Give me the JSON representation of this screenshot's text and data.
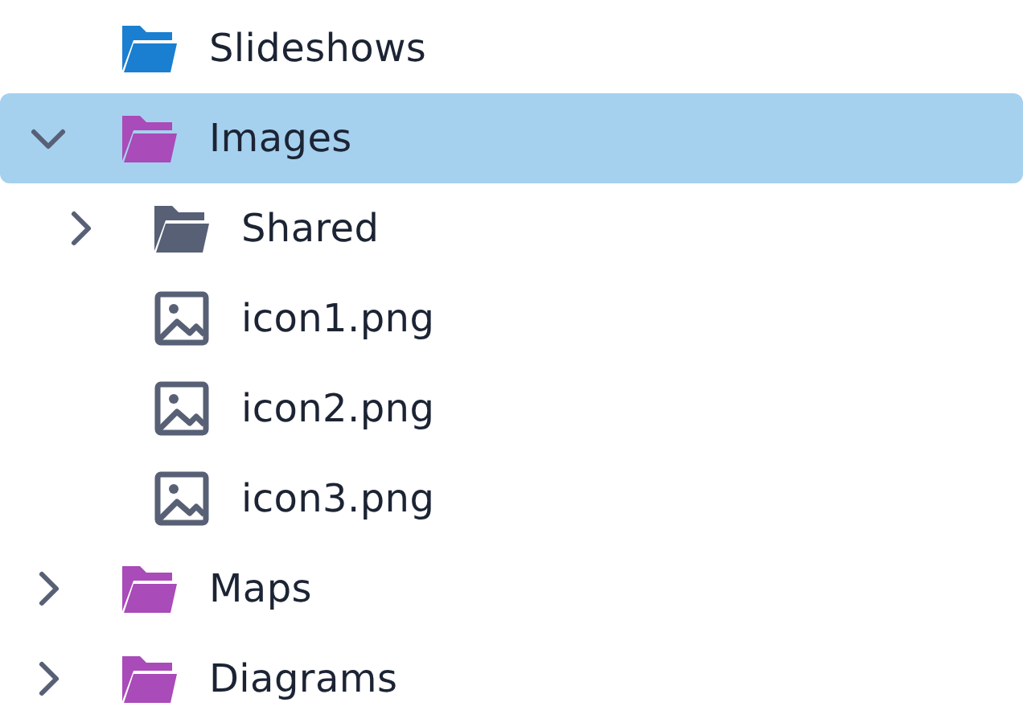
{
  "tree": [
    {
      "label": "Slideshows",
      "kind": "folder",
      "color": "#1a7fd0",
      "selected": false
    },
    {
      "label": "Images",
      "kind": "folder",
      "color": "#a94bb8",
      "expanded": true,
      "selected": true,
      "children": [
        {
          "label": "Shared",
          "kind": "folder",
          "color": "#576075",
          "expanded": false,
          "selected": false
        },
        {
          "label": "icon1.png",
          "kind": "image",
          "selected": false
        },
        {
          "label": "icon2.png",
          "kind": "image",
          "selected": false
        },
        {
          "label": "icon3.png",
          "kind": "image",
          "selected": false
        }
      ]
    },
    {
      "label": "Maps",
      "kind": "folder",
      "color": "#a94bb8",
      "expanded": false,
      "selected": false
    },
    {
      "label": "Diagrams",
      "kind": "folder",
      "color": "#a94bb8",
      "expanded": false,
      "selected": false
    }
  ]
}
